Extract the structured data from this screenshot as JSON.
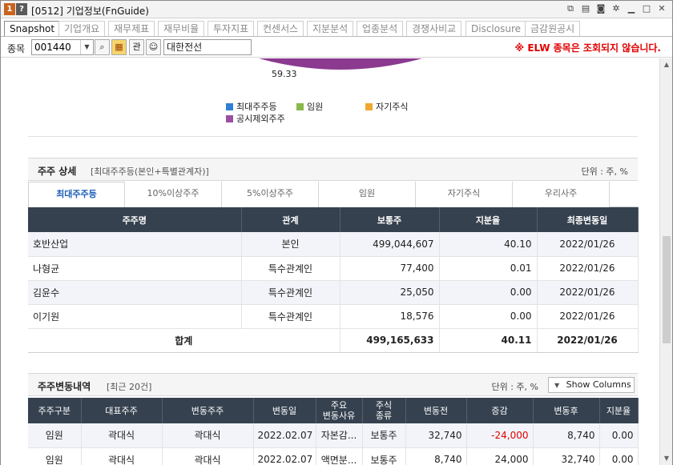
{
  "window": {
    "number": "1",
    "help": "?",
    "title": "[0512] 기업정보(FnGuide)"
  },
  "tabs": [
    "Snapshot",
    "기업개요",
    "재무제표",
    "재무비율",
    "투자지표",
    "컨센서스",
    "지분분석",
    "업종분석",
    "경쟁사비교",
    "Disclosure",
    "금감원공시"
  ],
  "search": {
    "label": "종목",
    "code": "001440",
    "gwan": "관",
    "name": "대한전선"
  },
  "warning": "※ ELW 종목은 조회되지 않습니다.",
  "pie": {
    "visible_label": "59.33",
    "legend": [
      {
        "name": "최대주주등",
        "color": "#2f7fd6"
      },
      {
        "name": "임원",
        "color": "#8ab84a"
      },
      {
        "name": "자기주식",
        "color": "#f0a830"
      },
      {
        "name": "공시제외주주",
        "color": "#9b4fa0"
      }
    ]
  },
  "section1": {
    "title": "주주 상세",
    "subtitle": "[최대주주등(본인+특별관계자)]",
    "unit": "단위 : 주, %",
    "subtabs": [
      "최대주주등",
      "10%이상주주",
      "5%이상주주",
      "임원",
      "자기주식",
      "우리사주"
    ],
    "columns": [
      "주주명",
      "관계",
      "보통주",
      "지분율",
      "최종변동일"
    ],
    "rows": [
      [
        "호반산업",
        "본인",
        "499,044,607",
        "40.10",
        "2022/01/26"
      ],
      [
        "나형균",
        "특수관계인",
        "77,400",
        "0.01",
        "2022/01/26"
      ],
      [
        "김윤수",
        "특수관계인",
        "25,050",
        "0.00",
        "2022/01/26"
      ],
      [
        "이기원",
        "특수관계인",
        "18,576",
        "0.00",
        "2022/01/26"
      ]
    ],
    "total": [
      "합계",
      "499,165,633",
      "40.11",
      "2022/01/26"
    ]
  },
  "section2": {
    "title": "주주변동내역",
    "subtitle": "[최근 20건]",
    "unit": "단위 : 주, %",
    "show_columns": "Show Columns",
    "columns": [
      "주주구분",
      "대표주주",
      "변동주주",
      "변동일",
      "주요\n변동사유",
      "주식\n종류",
      "변동전",
      "증감",
      "변동후",
      "지분율"
    ],
    "rows": [
      [
        "임원",
        "곽대식",
        "곽대식",
        "2022.02.07",
        "자본감...",
        "보통주",
        "32,740",
        "-24,000",
        "8,740",
        "0.00"
      ],
      [
        "임원",
        "곽대식",
        "곽대식",
        "2022.02.07",
        "액면분...",
        "보통주",
        "8,740",
        "24,000",
        "32,740",
        "0.00"
      ]
    ]
  }
}
